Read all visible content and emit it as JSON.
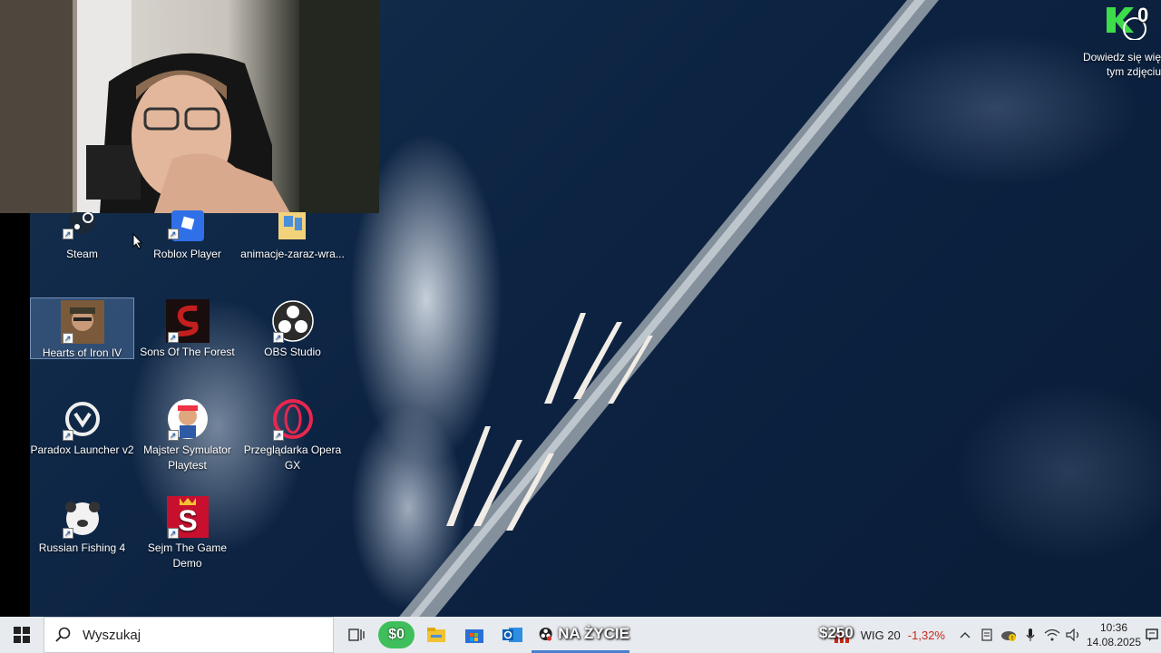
{
  "desktop": {
    "icons": [
      {
        "label": "Steam",
        "icon": "steam-icon"
      },
      {
        "label": "Roblox Player",
        "icon": "roblox-icon"
      },
      {
        "label": "animacje-zaraz-wra...",
        "icon": "folder-icon"
      },
      {
        "label": "Hearts of Iron IV",
        "icon": "hearts-of-iron-icon"
      },
      {
        "label": "Sons Of The Forest",
        "icon": "sons-of-the-forest-icon"
      },
      {
        "label": "OBS Studio",
        "icon": "obs-icon"
      },
      {
        "label": "Paradox Launcher v2",
        "icon": "paradox-icon"
      },
      {
        "label": "Majster Symulator Playtest",
        "icon": "majster-icon"
      },
      {
        "label": "Przeglądarka Opera GX",
        "icon": "opera-gx-icon"
      },
      {
        "label": "Russian Fishing 4",
        "icon": "russian-fishing-icon"
      },
      {
        "label": "Sejm The Game Demo",
        "icon": "sejm-icon"
      }
    ]
  },
  "watermark": {
    "line1": "Dowiedz się wię",
    "line2": "tym zdjęciu",
    "counter": "0"
  },
  "taskbar": {
    "search_placeholder": "Wyszukaj",
    "badge_money": "$0",
    "stream_title": "NA ŻYCIE",
    "badge_money2": "$250",
    "stock_name": "WIG 20",
    "stock_change": "-1,32%",
    "time": "10:36",
    "date": "14.08.2025"
  },
  "colors": {
    "taskbar_bg": "#e7eaee",
    "stock_negative": "#c42b1c",
    "accent": "#4a7fd0"
  }
}
